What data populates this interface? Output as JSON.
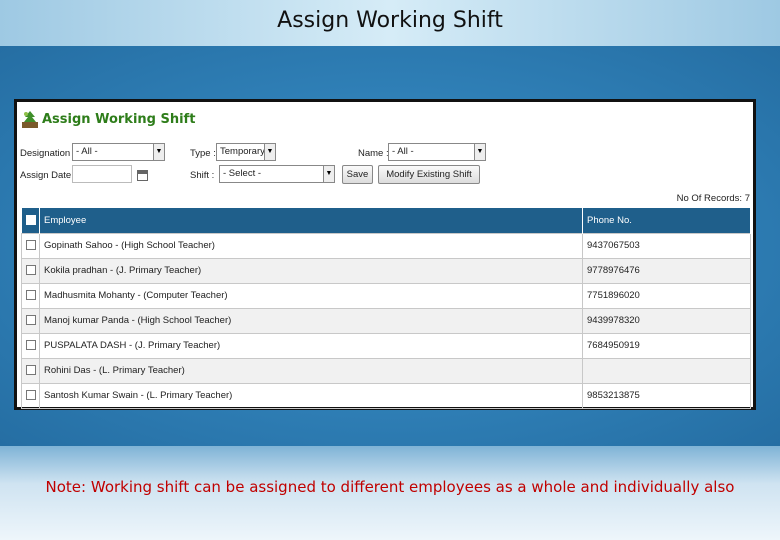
{
  "slide": {
    "title": "Assign Working Shift",
    "note": "Note: Working shift can be assigned to different employees as a whole and individually also"
  },
  "app": {
    "title": "Assign Working Shift",
    "logo_icon": "leaf-logo-icon"
  },
  "filters": {
    "designation_label": "Designation :",
    "designation_value": "- All -",
    "type_label": "Type :",
    "type_value": "Temporary",
    "name_label": "Name :",
    "name_value": "- All -",
    "assign_date_label": "Assign Date:",
    "assign_date_value": "",
    "shift_label": "Shift :",
    "shift_value": "- Select -"
  },
  "buttons": {
    "save": "Save",
    "modify": "Modify Existing Shift"
  },
  "records_label": "No Of Records: 7",
  "table": {
    "headers": {
      "employee": "Employee",
      "phone": "Phone No."
    },
    "rows": [
      {
        "employee": "Gopinath Sahoo - (High School Teacher)",
        "phone": "9437067503"
      },
      {
        "employee": "Kokila pradhan - (J. Primary Teacher)",
        "phone": "9778976476"
      },
      {
        "employee": "Madhusmita Mohanty - (Computer Teacher)",
        "phone": "7751896020"
      },
      {
        "employee": "Manoj kumar Panda - (High School Teacher)",
        "phone": "9439978320"
      },
      {
        "employee": "PUSPALATA DASH - (J. Primary Teacher)",
        "phone": "7684950919"
      },
      {
        "employee": "Rohini Das - (L. Primary Teacher)",
        "phone": ""
      },
      {
        "employee": "Santosh Kumar Swain - (L. Primary Teacher)",
        "phone": "9853213875"
      }
    ]
  },
  "colors": {
    "header_bg": "#1f5f8b",
    "app_title": "#2e7d1a",
    "note": "#c00000"
  }
}
